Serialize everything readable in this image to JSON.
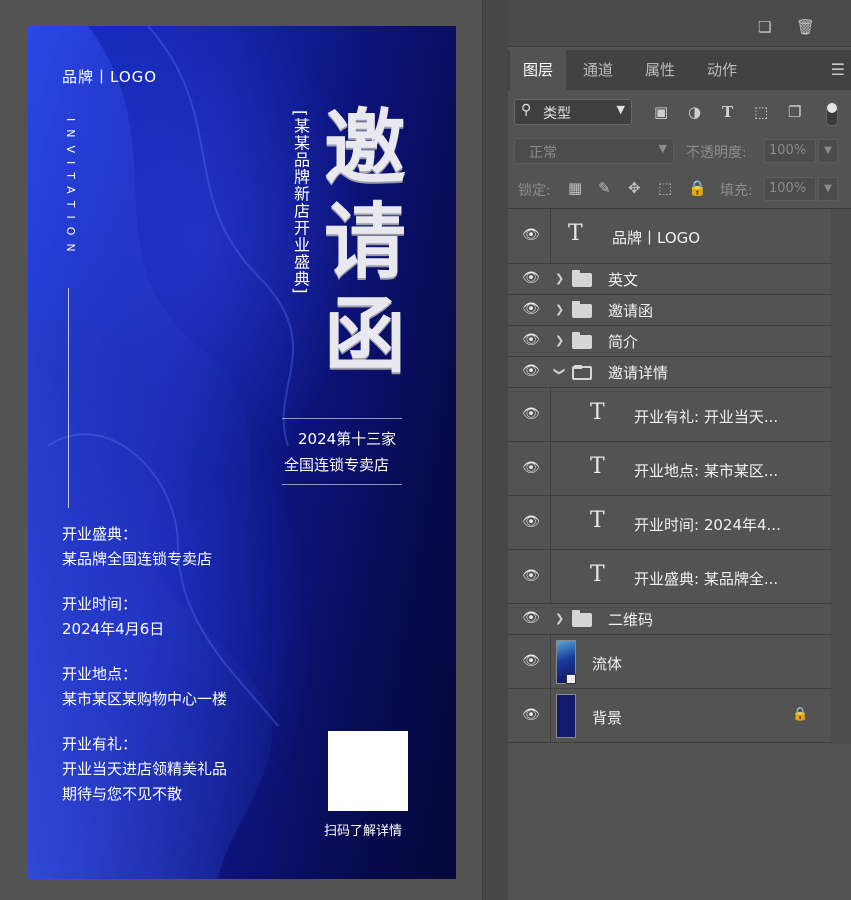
{
  "poster": {
    "brand": "品牌丨LOGO",
    "invitation_en": "INVITATION",
    "subtitle": "[某某品牌新店开业盛典]",
    "title_chars": [
      "邀",
      "请",
      "函"
    ],
    "store_line1": "2024第十三家",
    "store_line2": "全国连锁专卖店",
    "info": [
      {
        "label": "开业盛典：",
        "value": "某品牌全国连锁专卖店"
      },
      {
        "label": "开业时间：",
        "value": "2024年4月6日"
      },
      {
        "label": "开业地点：",
        "value": "某市某区某购物中心一楼"
      },
      {
        "label": "开业有礼：",
        "value": "开业当天进店领精美礼品",
        "value2": "期待与您不见不散"
      }
    ],
    "qr_caption": "扫码了解详情"
  },
  "panel": {
    "top_icons": [
      "new-layer-icon",
      "trash-icon"
    ],
    "tabs": [
      {
        "label": "图层",
        "active": true
      },
      {
        "label": "通道",
        "active": false
      },
      {
        "label": "属性",
        "active": false
      },
      {
        "label": "动作",
        "active": false
      }
    ],
    "filter": {
      "label": "类型",
      "icons": [
        "image-filter-icon",
        "adjustment-filter-icon",
        "type-filter-icon",
        "shape-filter-icon",
        "smartobject-filter-icon"
      ]
    },
    "blend_mode": "正常",
    "opacity_label": "不透明度:",
    "opacity_value": "100%",
    "lock_label": "锁定:",
    "fill_label": "填充:",
    "fill_value": "100%",
    "layers": [
      {
        "type": "text",
        "name": "品牌丨LOGO",
        "indent": 0
      },
      {
        "type": "group",
        "name": "英文",
        "open": false
      },
      {
        "type": "group",
        "name": "邀请函",
        "open": false
      },
      {
        "type": "group",
        "name": "简介",
        "open": false
      },
      {
        "type": "group",
        "name": "邀请详情",
        "open": true
      },
      {
        "type": "text",
        "name": "开业有礼:  开业当天...",
        "indent": 1
      },
      {
        "type": "text",
        "name": "开业地点:  某市某区...",
        "indent": 1
      },
      {
        "type": "text",
        "name": "开业时间:  2024年4...",
        "indent": 1
      },
      {
        "type": "text",
        "name": "开业盛典:  某品牌全...",
        "indent": 1
      },
      {
        "type": "group",
        "name": "二维码",
        "open": false
      },
      {
        "type": "smart",
        "name": "流体"
      },
      {
        "type": "background",
        "name": "背景",
        "locked": true
      }
    ],
    "colors": {
      "panel_bg": "#535353",
      "poster_blue": "#1424a8",
      "bg_thumb": "#101a6e"
    }
  }
}
